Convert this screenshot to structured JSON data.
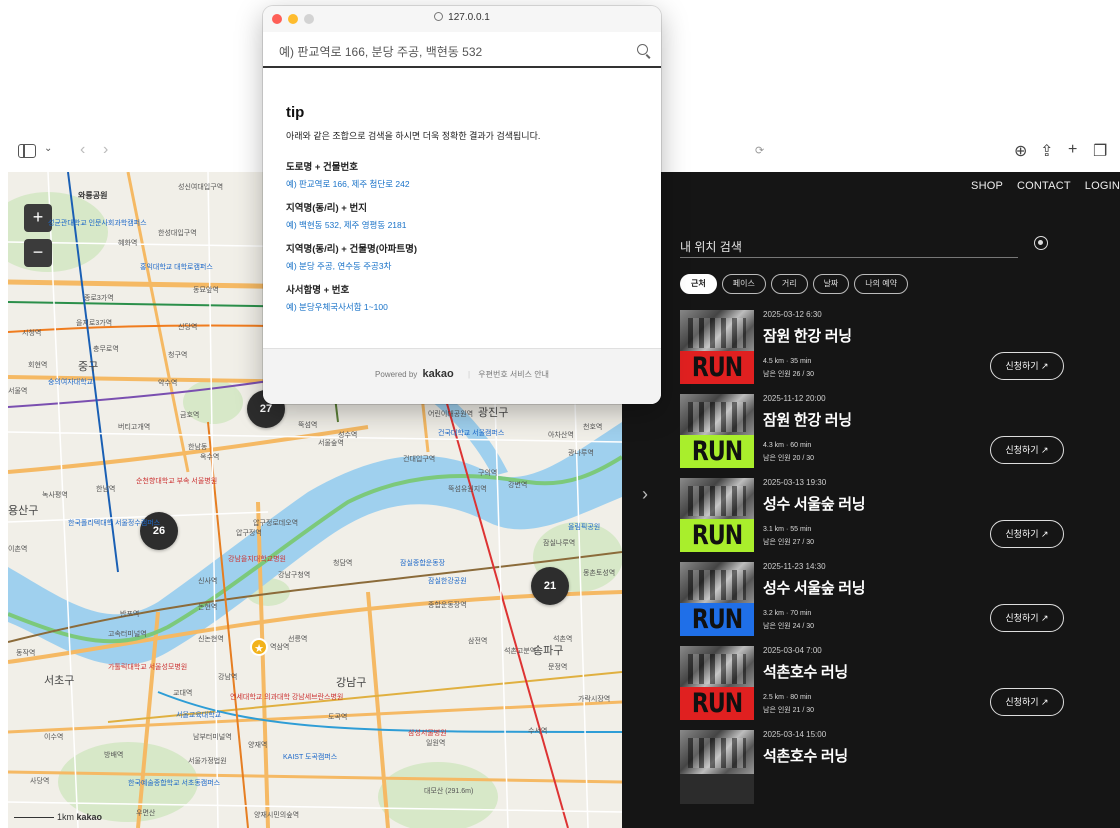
{
  "popup": {
    "url": "127.0.0.1",
    "search_placeholder": "예) 판교역로 166, 분당 주공, 백현동 532",
    "tip_title": "tip",
    "tip_desc": "아래와 같은 조합으로 검색을 하시면 더욱 정확한 결과가 검색됩니다.",
    "tips": [
      {
        "head": "도로명 + 건물번호",
        "example": "예) 판교역로 166,  제주 첨단로 242"
      },
      {
        "head": "지역명(동/리) + 번지",
        "example": "예) 백현동 532,  제주 영평동 2181"
      },
      {
        "head": "지역명(동/리) + 건물명(아파트명)",
        "example": "예) 분당 주공,  연수동 주공3차"
      },
      {
        "head": "사서함명 + 번호",
        "example": "예) 분당우체국사서함 1~100"
      }
    ],
    "footer_powered": "Powered by",
    "footer_brand": "kakao",
    "footer_link": "우편번호 서비스 안내"
  },
  "browser": {
    "translate_icon": "translate-icon",
    "right_icons": [
      "download-icon",
      "share-icon",
      "new-tab-icon",
      "tabs-icon"
    ]
  },
  "map": {
    "zoom_in": "+",
    "zoom_out": "−",
    "clusters": [
      "27",
      "26",
      "21"
    ],
    "labels": {
      "l1": "와룡공원",
      "l2": "성신여대입구역",
      "l3": "성균관대학교 인문사회과학캠퍼스",
      "l4": "한성대입구역",
      "l5": "혜화역",
      "l6": "홍익대학교 대학로캠퍼스",
      "l7": "종로3가역",
      "l8": "동묘앞역",
      "l9": "을지로3가역",
      "l10": "신당역",
      "l11": "시청역",
      "l12": "충무로역",
      "l13": "청구역",
      "l14": "회현역",
      "l15": "중구",
      "l16": "숭의여자대학교",
      "l17": "약수역",
      "l18": "서울역",
      "l19": "버티고개역",
      "l20": "금호역",
      "l21": "한남동",
      "l22": "옥수역",
      "l23": "어린이대공원역",
      "l24": "광진구",
      "l25": "건국대학교 서울캠퍼스",
      "l26": "건대입구역",
      "l27": "성수역",
      "l28": "서울숲역",
      "l29": "뚝섬역",
      "l30": "뚝섬유원지역",
      "l31": "구의역",
      "l32": "강변역",
      "l33": "순천향대학교 부속 서울병원",
      "l34": "한남역",
      "l35": "녹사평역",
      "l36": "용산구",
      "l37": "한국폴리텍대학 서울정수캠퍼스",
      "l38": "이촌역",
      "l39": "압구정로데오역",
      "l40": "압구정역",
      "l41": "신사역",
      "l42": "강남을지대학교병원",
      "l43": "청담역",
      "l44": "강남구청역",
      "l45": "잠실종합운동장",
      "l46": "잠실한강공원",
      "l47": "종합운동장역",
      "l48": "선릉역",
      "l49": "신논현역",
      "l50": "고속터미널역",
      "l51": "논현역",
      "l52": "반포역",
      "l53": "동작역",
      "l54": "가톨릭대학교 서울성모병원",
      "l55": "서초구",
      "l56": "강남역",
      "l57": "역삼역",
      "l58": "강남구",
      "l59": "교대역",
      "l60": "서울교육대학교",
      "l61": "도곡역",
      "l62": "양재역",
      "l63": "KAIST 도곡캠퍼스",
      "l64": "연세대학교 의과대학 강남세브란스병원",
      "l65": "이수역",
      "l66": "방배역",
      "l67": "서울가정법원",
      "l68": "남부터미널역",
      "l69": "사당역",
      "l70": "한국예술종합학교 서초동캠퍼스",
      "l71": "우면산",
      "l72": "대모산 (291.6m)",
      "l73": "양재시민의숲역",
      "l74": "삼성서울병원",
      "l75": "일원역",
      "l76": "수서역",
      "l77": "가락시장역",
      "l78": "석촌역",
      "l79": "송파구",
      "l80": "문정역",
      "l81": "삼전역",
      "l82": "석촌고분역",
      "l83": "올림픽공원",
      "l84": "몽촌토성역",
      "l85": "잠실나루역",
      "l86": "천호역",
      "l87": "아차산역",
      "l88": "광나루역"
    },
    "scale": "1km",
    "brand": "kakao"
  },
  "panel": {
    "nav": [
      "SHOP",
      "CONTACT",
      "LOGIN"
    ],
    "search_label": "내 위치 검색",
    "filters": [
      "근처",
      "페이스",
      "거리",
      "날짜",
      "나의 예약"
    ],
    "run_label": "RUN ON",
    "apply_label": "신청하기 ↗",
    "items": [
      {
        "date": "2025-03-12 6:30",
        "title": "잠원 한강 러닝",
        "meta": "4.5 km  ·  35 min",
        "remain": "남은 인원 26 / 30",
        "band": "#e02020"
      },
      {
        "date": "2025-11-12 20:00",
        "title": "잠원 한강 러닝",
        "meta": "4.3 km  ·  60 min",
        "remain": "남은 인원 20 / 30",
        "band": "#a9ee2c"
      },
      {
        "date": "2025-03-13 19:30",
        "title": "성수 서울숲 러닝",
        "meta": "3.1 km  ·  55 min",
        "remain": "남은 인원 27 / 30",
        "band": "#a9ee2c"
      },
      {
        "date": "2025-11-23 14:30",
        "title": "성수 서울숲 러닝",
        "meta": "3.2 km  ·  70 min",
        "remain": "남은 인원 24 / 30",
        "band": "#1f6fe8"
      },
      {
        "date": "2025-03-04 7:00",
        "title": "석촌호수 러닝",
        "meta": "2.5 km  ·  80 min",
        "remain": "남은 인원 21 / 30",
        "band": "#e02020"
      },
      {
        "date": "2025-03-14 15:00",
        "title": "석촌호수 러닝",
        "meta": "",
        "remain": "",
        "band": "#e02020"
      }
    ]
  }
}
